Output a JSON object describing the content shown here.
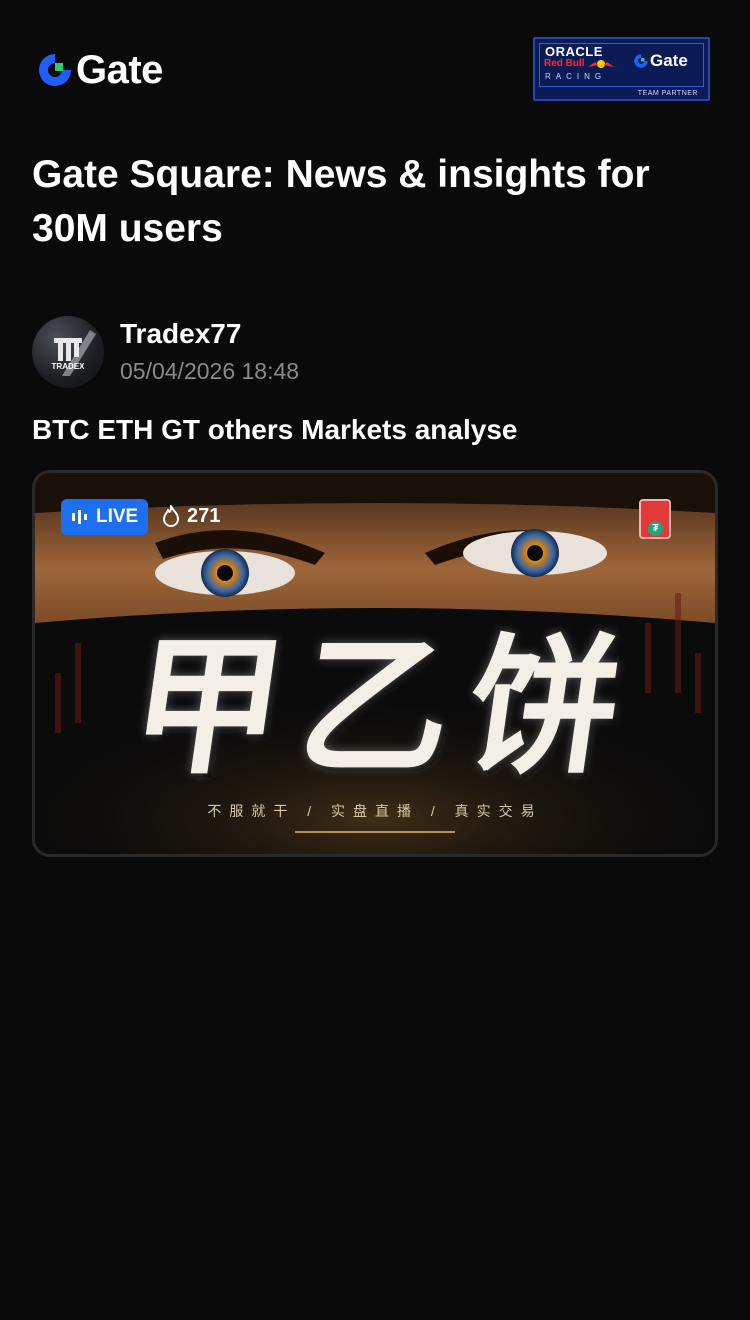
{
  "header": {
    "brand_name": "Gate",
    "partner": {
      "oracle": "ORACLE",
      "redbull": "Red Bull",
      "racing": "RACING",
      "gate": "Gate",
      "team": "TEAM PARTNER"
    }
  },
  "page_title": "Gate Square: News & insights for 30M users",
  "post": {
    "author": {
      "name": "Tradex77",
      "timestamp": "05/04/2026 18:48",
      "avatar_text": "TRADEX"
    },
    "title": "BTC ETH GT others Markets analyse",
    "live": {
      "label": "LIVE",
      "viewers": "271",
      "cover_title": "甲乙饼",
      "cover_tagline": "不服就干 / 实盘直播 / 真实交易"
    }
  },
  "colors": {
    "background": "#0a0a0a",
    "accent_blue": "#1d6ff2",
    "muted_text": "#8a8a8a",
    "brand_green": "#2ecc71",
    "brand_blue": "#1e5eff"
  },
  "icons": {
    "brand": "gate-logo-icon",
    "live": "live-bars-icon",
    "viewers": "flame-icon",
    "packet": "red-packet-icon"
  }
}
